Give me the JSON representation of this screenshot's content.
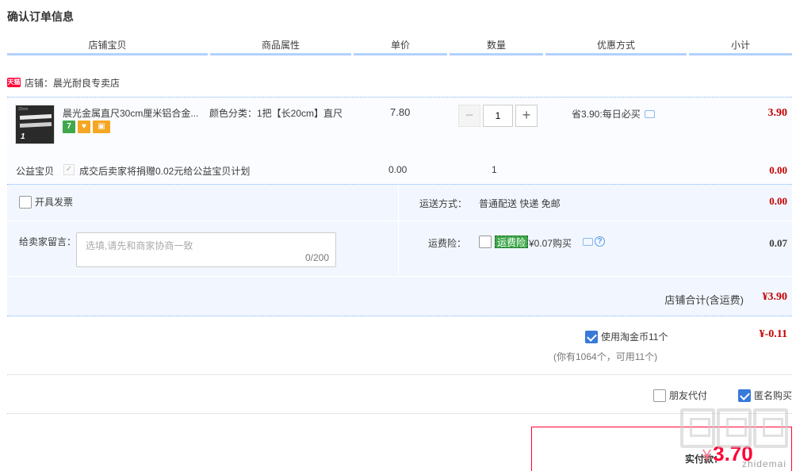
{
  "page": {
    "title": "确认订单信息"
  },
  "columns": [
    "店铺宝贝",
    "商品属性",
    "单价",
    "数量",
    "优惠方式",
    "小计"
  ],
  "shop": {
    "badge": "天猫",
    "label": "店铺：晨光耐良专卖店"
  },
  "item": {
    "thumb_label": "1",
    "thumb_brand": "20cm",
    "name": "晨光金属直尺30cm厘米铝合金...",
    "service_icons": [
      "seven-day-return-icon",
      "guarantee-icon",
      "card-icon"
    ],
    "seven_label": "7",
    "attr": "颜色分类：1把【长20cm】直尺",
    "price": "7.80",
    "quantity": "1",
    "discount": "省3.90:每日必买",
    "subtotal": "3.90"
  },
  "charity": {
    "label": "公益宝贝",
    "text": "成交后卖家将捐赠0.02元给公益宝贝计划",
    "price": "0.00",
    "qty": "1",
    "subtotal": "0.00"
  },
  "options": {
    "invoice_label": "开具发票",
    "shipping_label": "运送方式：",
    "shipping_value": "普通配送 快递 免邮",
    "shipping_fee": "0.00",
    "message_label": "给卖家留言：",
    "message_placeholder": "选填,请先和商家协商一致",
    "message_count": "0/200",
    "insurance_label": "运费险：",
    "insurance_tag": "运费险",
    "insurance_text": "¥0.07购买",
    "insurance_fee": "0.07",
    "shop_total_label": "店铺合计(含运费)",
    "shop_total": "¥3.90"
  },
  "coins": {
    "label": "使用淘金币11个",
    "note": "(你有1064个，可用11个)",
    "value": "¥-0.11",
    "checked": true
  },
  "friend_pay": {
    "label": "朋友代付",
    "checked": false
  },
  "anonymous": {
    "label": "匿名购买",
    "checked": true
  },
  "payment": {
    "label": "实付款：",
    "currency": "¥",
    "amount": "3.70"
  },
  "watermark": {
    "text": "zhidemai"
  },
  "colors": {
    "accent": "#3879d9",
    "price_red": "#c40000",
    "tmall_red": "#ff0036",
    "header_blue": "#b2d1ff"
  }
}
